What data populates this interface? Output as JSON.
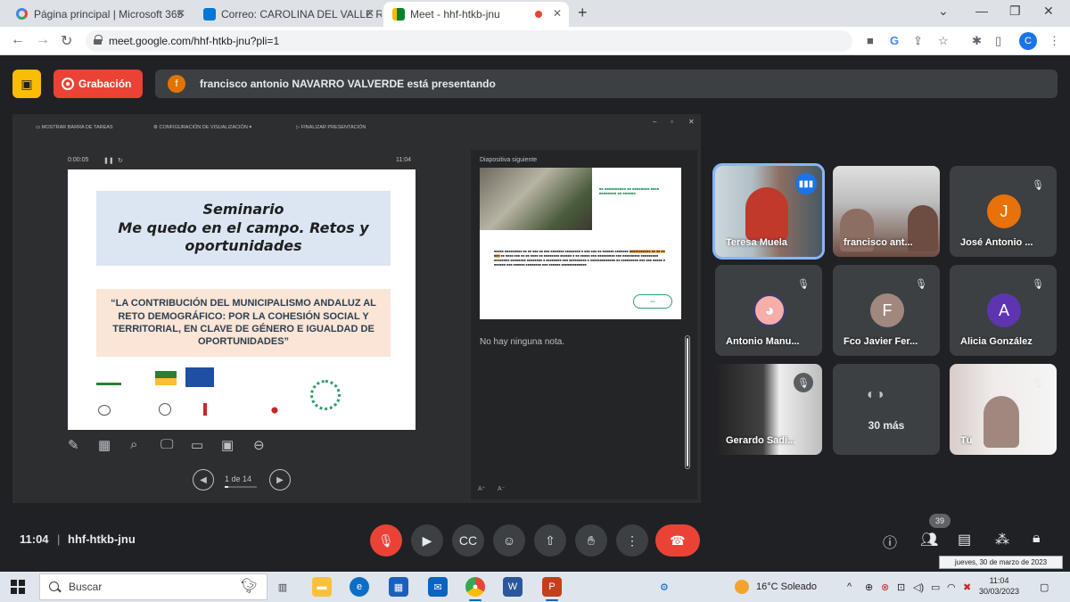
{
  "browser": {
    "tabs": [
      {
        "label": "Página principal | Microsoft 365",
        "icon": "google-g-icon",
        "color": "#4285f4"
      },
      {
        "label": "Correo: CAROLINA DEL VALLE RA",
        "icon": "outlook-icon",
        "color": "#0078d4"
      },
      {
        "label": "Meet - hhf-htkb-jnu",
        "icon": "meet-icon",
        "color": "#00832d"
      }
    ],
    "url": "meet.google.com/hhf-htkb-jnu?pli=1",
    "profile_initial": "C"
  },
  "meet": {
    "recording_label": "Grabación",
    "presenter_initial": "f",
    "presenter_text": "francisco antonio NAVARRO VALVERDE está presentando",
    "toolbar": {
      "show_taskbar": "MOSTRAR BARRA DE TAREAS",
      "display_settings": "CONFIGURACIÓN DE VISUALIZACIÓN ▾",
      "end_presentation": "FINALIZAR PRESENTACIÓN"
    },
    "elapsed": "0:00:05",
    "slide_clock": "11:04",
    "slide": {
      "title_line1": "Seminario",
      "title_line2": "Me quedo en el campo. Retos y",
      "title_line3": "oportunidades",
      "subtitle": "“LA CONTRIBUCIÓN DEL MUNICIPALISMO ANDALUZ AL RETO DEMOGRÁFICO: POR LA COHESIÓN SOCIAL Y TERRITORIAL, EN CLAVE DE GÉNERO E IGUALDAD DE OPORTUNIDADES”"
    },
    "next_slide_label": "Diapositiva siguiente",
    "notes_text": "No hay ninguna nota.",
    "page_indicator": "1 de 14",
    "participants": [
      {
        "name": "Teresa Muela",
        "type": "video",
        "speaking": true
      },
      {
        "name": "francisco ant...",
        "type": "video",
        "speaking": false
      },
      {
        "name": "José Antonio ...",
        "type": "avatar",
        "initial": "J",
        "color": "#e8710a"
      },
      {
        "name": "Antonio Manu...",
        "type": "avatar-image",
        "color": "#f6aea9"
      },
      {
        "name": "Fco Javier Fer...",
        "type": "avatar",
        "initial": "F",
        "color": "#a1887f"
      },
      {
        "name": "Alicia González",
        "type": "avatar",
        "initial": "A",
        "color": "#5e35b1"
      },
      {
        "name": "Gerardo Sadi...",
        "type": "video",
        "speaking": false
      },
      {
        "name": "30 más",
        "type": "more"
      },
      {
        "name": "Tú",
        "type": "video",
        "speaking": false
      }
    ],
    "time": "11:04",
    "meeting_code": "hhf-htkb-jnu",
    "people_count": "39",
    "tooltip": "jueves, 30 de marzo de 2023"
  },
  "taskbar": {
    "search_placeholder": "Buscar",
    "weather": "16°C  Soleado",
    "clock_time": "11:04",
    "clock_date": "30/03/2023"
  }
}
